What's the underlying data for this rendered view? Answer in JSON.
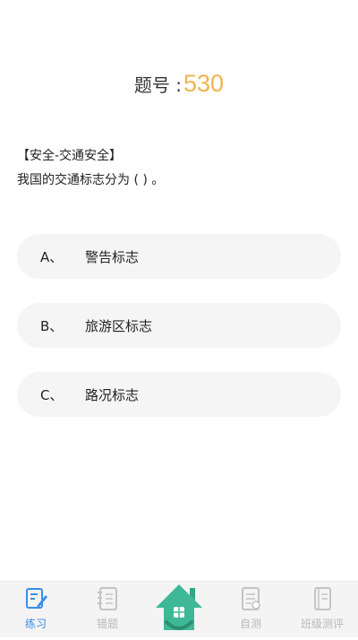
{
  "question": {
    "number_label": "题号 :",
    "number": "530",
    "category": "【安全-交通安全】",
    "text": "我国的交通标志分为 ( ) 。"
  },
  "options": [
    {
      "letter": "A、",
      "text": "警告标志"
    },
    {
      "letter": "B、",
      "text": "旅游区标志"
    },
    {
      "letter": "C、",
      "text": "路况标志"
    }
  ],
  "tabbar": {
    "practice": "练习",
    "wrong": "错题",
    "self_test": "自测",
    "class_test": "班级测评",
    "home_icon": "home-icon"
  },
  "colors": {
    "number": "#f0b44c",
    "active_tab": "#3a8ee6",
    "inactive_tab": "#b9b9b9",
    "option_bg": "#f5f5f5",
    "home_green": "#3fb896"
  }
}
